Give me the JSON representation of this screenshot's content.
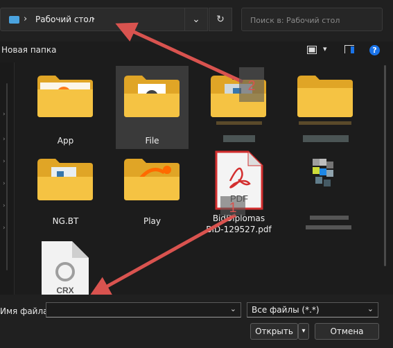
{
  "address": {
    "crumb": "Рабочий стол",
    "chevron": "›"
  },
  "refresh_icon": "↻",
  "dropdown_icon": "⌄",
  "search": {
    "placeholder": "Поиск в: Рабочий стол"
  },
  "toolbar": {
    "new_folder": "Новая папка",
    "help": "?",
    "view_caret": "▾"
  },
  "files": [
    {
      "name": "App",
      "type": "folder",
      "selected": false
    },
    {
      "name": "File",
      "type": "folder",
      "selected": true
    },
    {
      "name": "",
      "type": "folder-blurred",
      "selected": false
    },
    {
      "name": "",
      "type": "folder",
      "selected": false
    },
    {
      "name": "NG.BT",
      "type": "folder",
      "selected": false
    },
    {
      "name": "Play",
      "type": "folder",
      "selected": false
    },
    {
      "name": "BidDiplomas\nBID-129527.pdf",
      "line1": "BidDiplomas",
      "line2": "BID-129527.pdf",
      "type": "pdf",
      "selected": false
    },
    {
      "name": "",
      "type": "blurred",
      "selected": false
    },
    {
      "name": "",
      "type": "crx",
      "selected": false
    }
  ],
  "pdf_icon_text": "PDF",
  "crx_icon_text": "CRX",
  "annotations": [
    {
      "label": "1"
    },
    {
      "label": "2"
    }
  ],
  "footer": {
    "filename_label": "Имя файла:",
    "filename_value": "",
    "filetype": "Все файлы (*.*)",
    "open_button": "Открыть",
    "open_split": "▾",
    "cancel_button": "Отмена"
  },
  "colors": {
    "folder": "#f5c343",
    "folder_dark": "#e0a526",
    "arrow": "#d9534f",
    "selection": "#3a3a3a",
    "help": "#1a73e8"
  }
}
